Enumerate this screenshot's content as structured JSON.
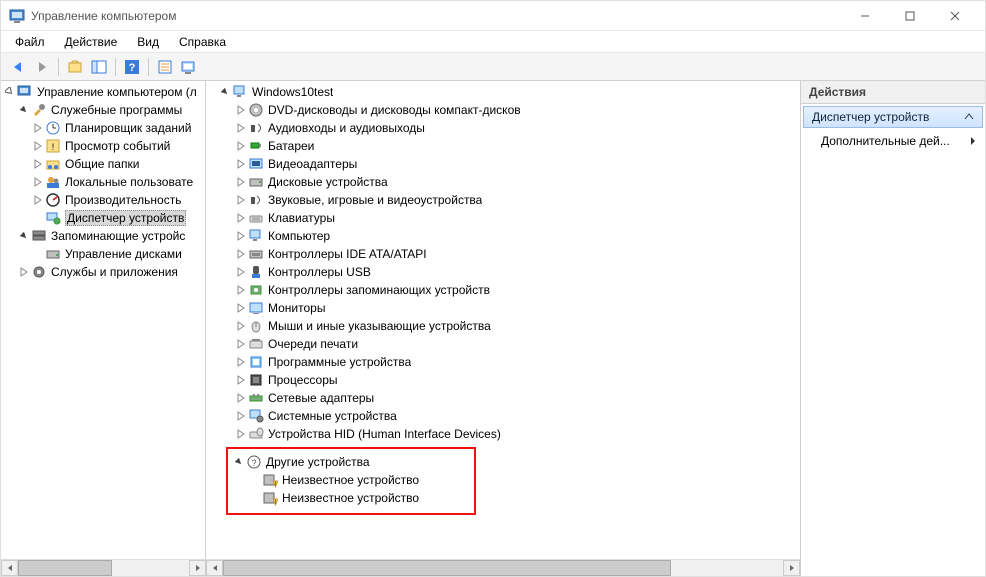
{
  "window": {
    "title": "Управление компьютером"
  },
  "menu": {
    "file": "Файл",
    "action": "Действие",
    "view": "Вид",
    "help": "Справка"
  },
  "left_tree": {
    "root": "Управление компьютером (л",
    "system_tools": "Служебные программы",
    "task_scheduler": "Планировщик заданий",
    "event_viewer": "Просмотр событий",
    "shared_folders": "Общие папки",
    "local_users": "Локальные пользовате",
    "performance": "Производительность",
    "device_manager": "Диспетчер устройств",
    "storage": "Запоминающие устройс",
    "disk_mgmt": "Управление дисками",
    "services": "Службы и приложения"
  },
  "devices": {
    "root": "Windows10test",
    "items": [
      "DVD-дисководы и дисководы компакт-дисков",
      "Аудиовходы и аудиовыходы",
      "Батареи",
      "Видеоадаптеры",
      "Дисковые устройства",
      "Звуковые, игровые и видеоустройства",
      "Клавиатуры",
      "Компьютер",
      "Контроллеры IDE ATA/ATAPI",
      "Контроллеры USB",
      "Контроллеры запоминающих устройств",
      "Мониторы",
      "Мыши и иные указывающие устройства",
      "Очереди печати",
      "Программные устройства",
      "Процессоры",
      "Сетевые адаптеры",
      "Системные устройства",
      "Устройства HID (Human Interface Devices)"
    ],
    "other_header": "Другие устройства",
    "unknown1": "Неизвестное устройство",
    "unknown2": "Неизвестное устройство"
  },
  "actions": {
    "header": "Действия",
    "selected": "Диспетчер устройств",
    "more": "Дополнительные дей..."
  }
}
